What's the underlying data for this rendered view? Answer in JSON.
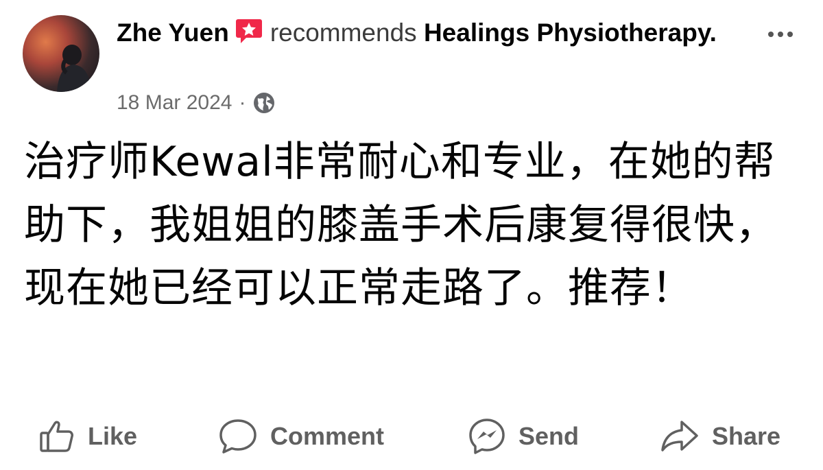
{
  "post": {
    "author": "Zhe Yuen",
    "verb": "recommends",
    "page_name": "Healings Physiotherapy.",
    "date": "18 Mar 2024",
    "separator": "·",
    "privacy_icon": "globe-icon",
    "body": "治疗师Kewal非常耐心和专业，在她的帮助下，我姐姐的膝盖手术后康复得很快，现在她已经可以正常走路了。推荐！"
  },
  "actions": {
    "like": "Like",
    "comment": "Comment",
    "send": "Send",
    "share": "Share"
  },
  "colors": {
    "badge": "#f02849",
    "text": "#050505",
    "muted": "#606060"
  }
}
